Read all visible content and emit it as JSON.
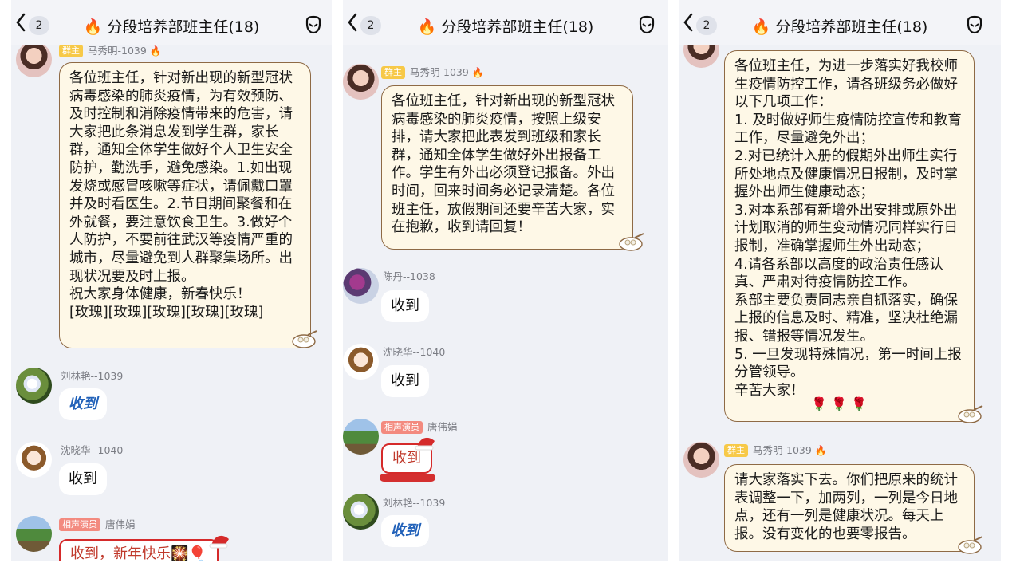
{
  "colors": {
    "panel_bg": "#eff1f6",
    "note_bg": "#fef8e7",
    "note_border": "#8e6a45",
    "blue_text": "#2161b9",
    "owner_badge": "#f7c948",
    "actor_badge": "#f38a7f"
  },
  "header": {
    "back_count": "2",
    "flame": "🔥",
    "title": "分段培养部班主任(18)",
    "icon": "emoji-icon"
  },
  "panels": [
    {
      "m0": {
        "badge": "群主",
        "sender": "马秀明-1039",
        "flame": "🔥",
        "text": "各位班主任，针对新出现的新型冠状病毒感染的肺炎疫情，为有效预防、及时控制和消除疫情带来的危害，请大家把此条消息发到学生群，家长群，通知全体学生做好个人卫生安全防护，勤洗手，避免感染。1.如出现发烧或感冒咳嗽等症状，请佩戴口罩并及时看医生。2.节日期间聚餐和在外就餐，要注意饮食卫生。3.做好个人防护，不要前往武汉等疫情严重的城市，尽量避免到人群聚集场所。出现状况要及时上报。\n祝大家身体健康，新春快乐！\n[玫瑰][玫瑰][玫瑰][玫瑰][玫瑰]"
      },
      "m1": {
        "sender": "刘林艳--1039",
        "text": "收到"
      },
      "m2": {
        "sender": "沈晓华--1040",
        "text": "收到"
      },
      "m3": {
        "badge": "相声演员",
        "sender": "唐伟娟",
        "text": "收到，新年快乐🎇🎈"
      }
    },
    {
      "m0": {
        "badge": "群主",
        "sender": "马秀明-1039",
        "flame": "🔥",
        "text": "各位班主任，针对新出现的新型冠状病毒感染的肺炎疫情，按照上级安排，请大家把此表发到班级和家长群，通知全体学生做好外出报备工作。学生有外出必须登记报备。外出时间，回来时间务必记录清楚。各位班主任，放假期间还要辛苦大家，实在抱歉，收到请回复！"
      },
      "m1": {
        "sender": "陈丹--1038",
        "text": "收到"
      },
      "m2": {
        "sender": "沈晓华--1040",
        "text": "收到"
      },
      "m3": {
        "badge": "相声演员",
        "sender": "唐伟娟",
        "text": "收到"
      },
      "m4": {
        "sender": "刘林艳--1039",
        "text": "收到"
      }
    },
    {
      "m0": {
        "text": "各位班主任，为进一步落实好我校师生疫情防控工作，请各班级务必做好以下几项工作：\n1. 及时做好师生疫情防控宣传和教育工作，尽量避免外出；\n2.对已统计入册的假期外出师生实行所处地点及健康情况日报制，及时掌握外出师生健康动态；\n3.对本系部有新增外出安排或原外出计划取消的师生变动情况同样实行日报制，准确掌握师生外出动态；\n4.请各系部以高度的政治责任感认真、严肃对待疫情防控工作。\n系部主要负责同志亲自抓落实，确保上报的信息及时、精准，坚决杜绝漏报、错报等情况发生。\n5. 一旦发现特殊情况，第一时间上报分管领导。\n辛苦大家！",
        "roses": "🌹 🌹 🌹"
      },
      "m1": {
        "badge": "群主",
        "sender": "马秀明-1039",
        "flame": "🔥",
        "text": "请大家落实下去。你们把原来的统计表调整一下，加两列，一列是今日地点，还有一列是健康状况。每天上报。没有变化的也要零报告。"
      }
    }
  ]
}
